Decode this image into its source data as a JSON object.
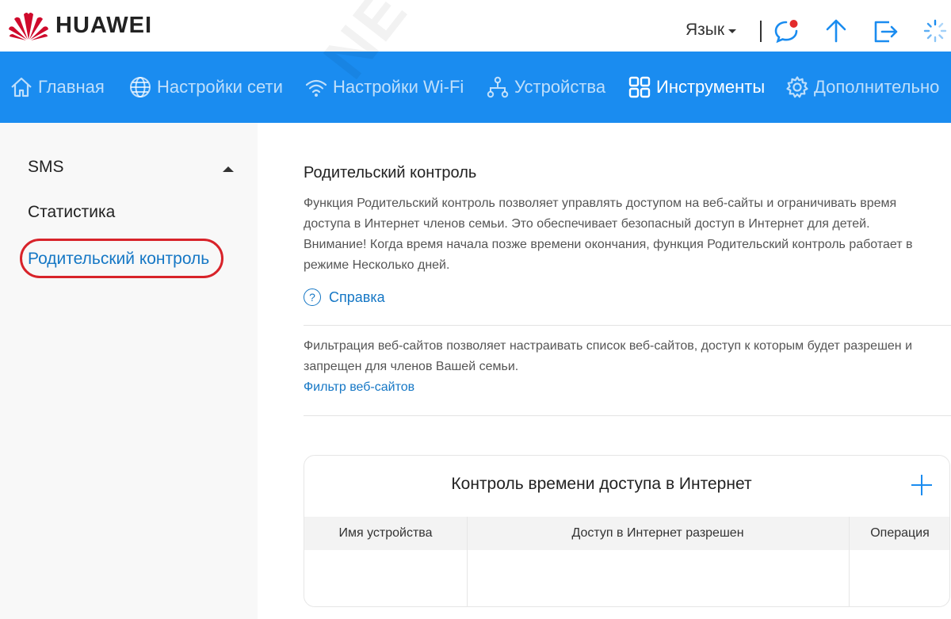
{
  "brand": {
    "name": "HUAWEI",
    "logo_color": "#cf0a2c"
  },
  "header": {
    "language_label": "Язык",
    "icons": [
      "chat-bubble-icon",
      "upload-arrow-icon",
      "logout-icon",
      "loading-spinner-icon"
    ],
    "notification_dot_color": "#e32b2b"
  },
  "nav": {
    "background": "#1a8cf0",
    "items": [
      {
        "label": "Главная",
        "icon": "home-icon",
        "active": false
      },
      {
        "label": "Настройки сети",
        "icon": "globe-icon",
        "active": false
      },
      {
        "label": "Настройки Wi-Fi",
        "icon": "wifi-icon",
        "active": false
      },
      {
        "label": "Устройства",
        "icon": "devices-icon",
        "active": false
      },
      {
        "label": "Инструменты",
        "icon": "tools-grid-icon",
        "active": true
      },
      {
        "label": "Дополнительно",
        "icon": "gear-icon",
        "active": false
      }
    ]
  },
  "sidebar": {
    "items": [
      {
        "label": "SMS",
        "expandable": true
      },
      {
        "label": "Статистика"
      },
      {
        "label": "Родительский контроль",
        "active": true,
        "highlighted": true
      }
    ]
  },
  "main": {
    "title": "Родительский контроль",
    "description_lines": [
      "Функция Родительский контроль позволяет управлять доступом на веб-сайты и ограничивать время",
      "доступа в Интернет членов семьи. Это обеспечивает безопасный доступ в Интернет для детей.",
      "Внимание! Когда время начала позже времени окончания, функция Родительский контроль работает в",
      "режиме Несколько дней."
    ],
    "help_label": "Справка",
    "filter_description_lines": [
      "Фильтрация веб-сайтов позволяет настраивать список веб-сайтов, доступ к которым будет разрешен и",
      "запрещен для членов Вашей семьи."
    ],
    "filter_link": "Фильтр веб-сайтов",
    "access_control": {
      "title": "Контроль времени доступа в Интернет",
      "columns": [
        "Имя устройства",
        "Доступ в Интернет разрешен",
        "Операция"
      ],
      "rows": []
    }
  },
  "watermark": "NET-WELL.RU"
}
